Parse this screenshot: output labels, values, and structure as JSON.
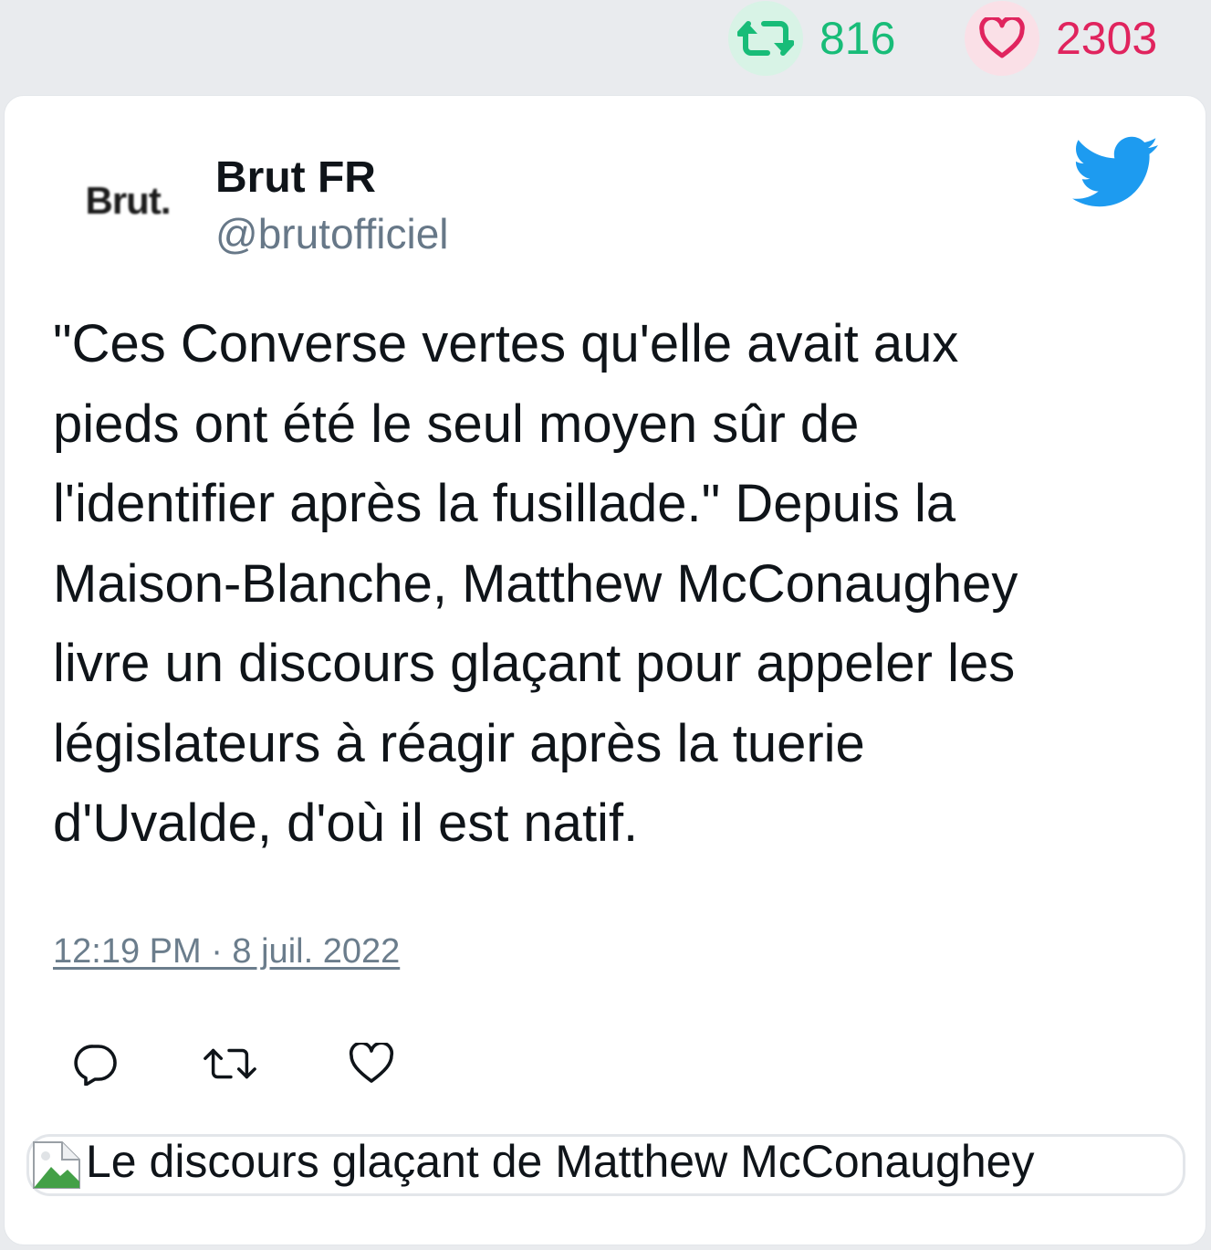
{
  "stats": {
    "retweet_count": "816",
    "like_count": "2303",
    "retweet_icon": "retweet-icon",
    "like_icon": "heart-icon",
    "colors": {
      "retweet": "#18bc78",
      "like": "#e0245e"
    }
  },
  "tweet": {
    "avatar_text": "Brut.",
    "author_name": "Brut FR",
    "author_handle": "@brutofficiel",
    "brand_icon": "twitter-bird-icon",
    "text_lines": [
      "\"Ces Converse vertes qu'elle avait aux",
      "pieds ont été le seul moyen sûr de",
      "l'identifier après la fusillade.\" Depuis la",
      "Maison-Blanche, Matthew McConaughey",
      "livre un discours glaçant pour appeler les",
      "législateurs à réagir après la tuerie",
      "d'Uvalde, d'où il est natif."
    ],
    "timestamp": "12:19 PM · 8 juil. 2022",
    "actions": [
      "reply-icon",
      "retweet-icon",
      "like-icon"
    ],
    "media_alt": "Le discours glaçant de Matthew McConaughey"
  }
}
